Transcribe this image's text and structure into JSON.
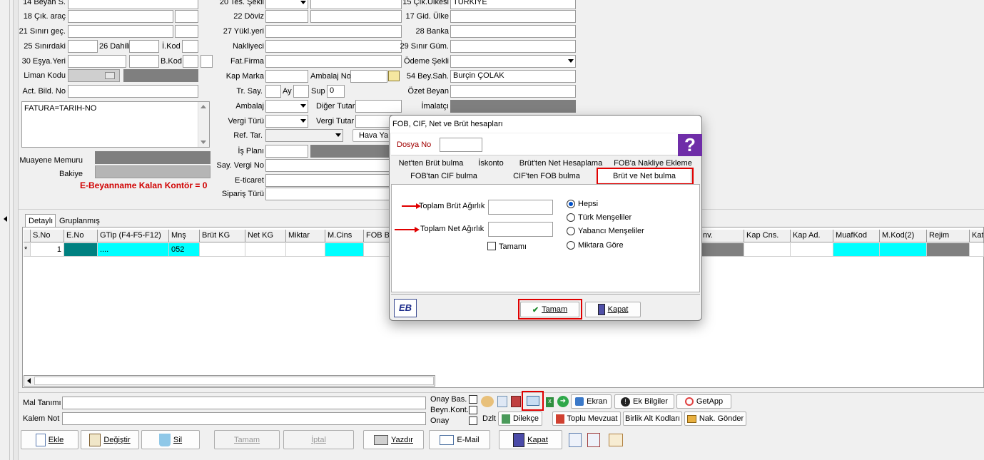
{
  "form": {
    "f14_label": "14 Beyan S.",
    "f18_label": "18 Çık. araç",
    "f21_label": "21 Sınırı geç.",
    "f25_label": "25 Sınırdaki",
    "f26_label": "26 Dahili",
    "ikod_label": "İ.Kod",
    "f30_label": "30 Eşya.Yeri",
    "bkod_label": "B.Kod",
    "liman_label": "Liman Kodu",
    "actbild_label": "Act. Bild. No",
    "notes_value": "FATURA=TARIH-NO",
    "muayene_label": "Muayene Memuru",
    "bakiye_label": "Bakiye",
    "kontor_text": "E-Beyanname Kalan Kontör = 0",
    "f20_label": "20 Tes. Şekli",
    "f22_label": "22 Döviz",
    "f27_label": "27 Yükl.yeri",
    "nakliyeci_label": "Nakliyeci",
    "fatfirma_label": "Fat.Firma",
    "kapmarka_label": "Kap Marka",
    "ambalajno_label": "Ambalaj No",
    "trsay_label": "Tr. Say.",
    "ay_label": "Ay",
    "sup_label": "Sup",
    "sup_value": "0",
    "ambalaj_label": "Ambalaj",
    "digertutar_label": "Diğer Tutar",
    "vergituru_label": "Vergi Türü",
    "vergitutar_label": "Vergi Tutar",
    "reftar_label": "Ref. Tar.",
    "havaya_label": "Hava Ya",
    "isplani_label": "İş Planı",
    "sayvergi_label": "Say. Vergi No",
    "eticaret_label": "E-ticaret",
    "siparis_label": "Sipariş Türü",
    "f15_label": "15 Çık.Ülkesi",
    "f15_value": "TÜRKİYE",
    "f17_label": "17 Gid. Ülke",
    "f28_label": "28 Banka",
    "f29_label": "29 Sınır Güm.",
    "odeme_label": "Ödeme Şekli",
    "f54_label": "54 Bey.Sah.",
    "f54_value": "Burçin ÇOLAK",
    "ozet_label": "Özet Beyan",
    "imalatci_label": "İmalatçı"
  },
  "grid": {
    "tabs": [
      "Detaylı",
      "Gruplanmış"
    ],
    "headers": [
      "S.No",
      "E.No",
      "GTip (F4-F5-F12)",
      "Mnş",
      "Brüt KG",
      "Net KG",
      "Miktar",
      "M.Cins",
      "FOB B"
    ],
    "headers_right": [
      "nv.",
      "Kap Cns.",
      "Kap Ad.",
      "MuafKod",
      "M.Kod(2)",
      "Rejim",
      "Kat"
    ],
    "row": {
      "marker": "*",
      "sno": "1",
      "gtip": "....",
      "mns": "052"
    }
  },
  "bottom": {
    "maltanimi_label": "Mal Tanımı",
    "kalemnot_label": "Kalem Not",
    "onaybas_label": "Onay Bas.",
    "beynkont_label": "Beyn.Kont.",
    "onay_label": "Onay",
    "dzlt_label": "Dzlt",
    "ekran_label": "Ekran",
    "ekbilgiler_label": "Ek Bilgiler",
    "getapp_label": "GetApp",
    "dilekce_label": "Dilekçe",
    "toplumevzuat_label": "Toplu Mevzuat",
    "birlikalt_label": "Birlik Alt Kodları",
    "nakgonder_label": "Nak. Gönder",
    "ekle_label": "Ekle",
    "degistir_label": "Değiştir",
    "sil_label": "Sil",
    "tamam_label": "Tamam",
    "iptal_label": "İptal",
    "yazdir_label": "Yazdır",
    "email_label": "E-Mail",
    "kapat_label": "Kapat"
  },
  "dialog": {
    "title": "FOB, CIF, Net ve Brüt hesapları",
    "dosyano_label": "Dosya No",
    "help_glyph": "?",
    "tabs_row1": [
      "Net'ten Brüt bulma",
      "İskonto",
      "Brüt'ten Net Hesaplama",
      "FOB'a Nakliye Ekleme"
    ],
    "tabs_row2": [
      "FOB'tan CIF bulma",
      "CIF'ten FOB bulma",
      "Brüt ve Net bulma"
    ],
    "toplam_brut_label": "Toplam Brüt Ağırlık",
    "toplam_net_label": "Toplam Net Ağırlık",
    "tamami_label": "Tamamı",
    "radios": [
      "Hepsi",
      "Türk Menşeliler",
      "Yabancı Menşeliler",
      "Miktara Göre"
    ],
    "selected_radio": "Hepsi",
    "logo_text": "EB",
    "ok_label": "Tamam",
    "close_label": "Kapat"
  },
  "colors": {
    "highlight": "#e00000",
    "cyan": "#00ffff",
    "teal": "#008080",
    "kontor_red": "#d00000",
    "help_purple": "#6f2da8"
  }
}
